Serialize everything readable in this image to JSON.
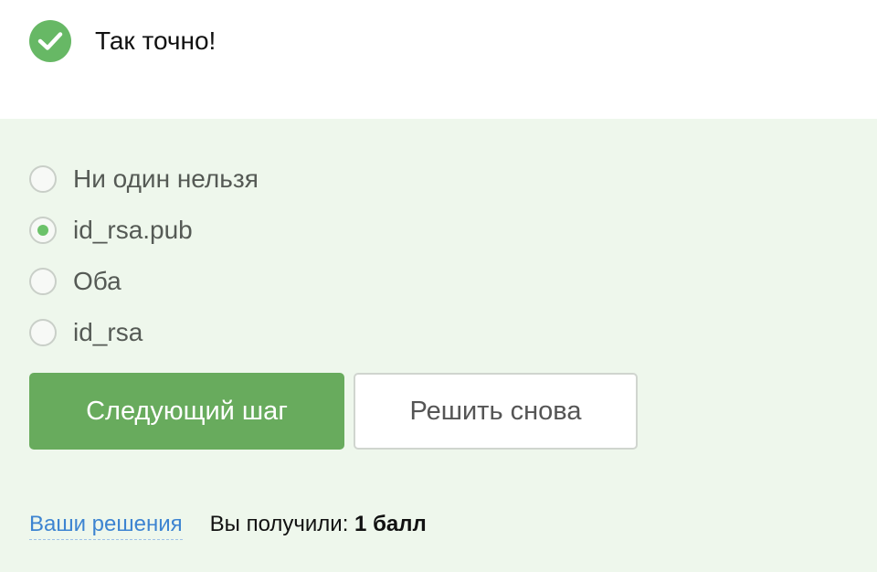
{
  "feedback": {
    "icon": "check-circle-icon",
    "text": "Так точно!",
    "color": "#67b865"
  },
  "options": [
    {
      "label": "Ни один нельзя",
      "selected": false
    },
    {
      "label": "id_rsa.pub",
      "selected": true
    },
    {
      "label": "Оба",
      "selected": false
    },
    {
      "label": "id_rsa",
      "selected": false
    }
  ],
  "buttons": {
    "next_step": "Следующий шаг",
    "solve_again": "Решить снова"
  },
  "footer": {
    "solutions_link": "Ваши решения",
    "score_label": "Вы получили:",
    "score_value": "1 балл"
  },
  "colors": {
    "panel_background": "#eef7ec",
    "primary_button": "#68ab5d",
    "link": "#3d84d1"
  }
}
